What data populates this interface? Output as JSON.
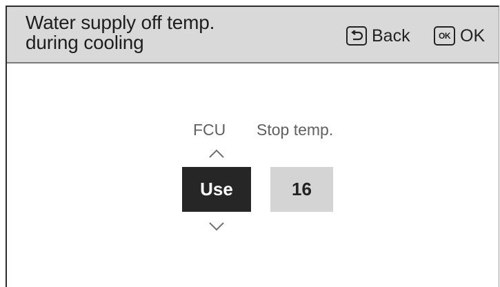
{
  "header": {
    "title_line1": "Water supply off temp.",
    "title_line2": "during cooling",
    "back_label": "Back",
    "ok_icon_text": "OK",
    "ok_label": "OK"
  },
  "main": {
    "fcu_label": "FCU",
    "stop_temp_label": "Stop temp.",
    "fcu_value": "Use",
    "stop_temp_value": "16"
  },
  "icons": {
    "back": "return-arrow-icon",
    "ok": "ok-key-icon",
    "up": "chevron-up-icon",
    "down": "chevron-down-icon"
  },
  "colors": {
    "header_bg": "#d9d9d9",
    "selected_bg": "#262626",
    "unselected_bg": "#d4d4d4"
  }
}
